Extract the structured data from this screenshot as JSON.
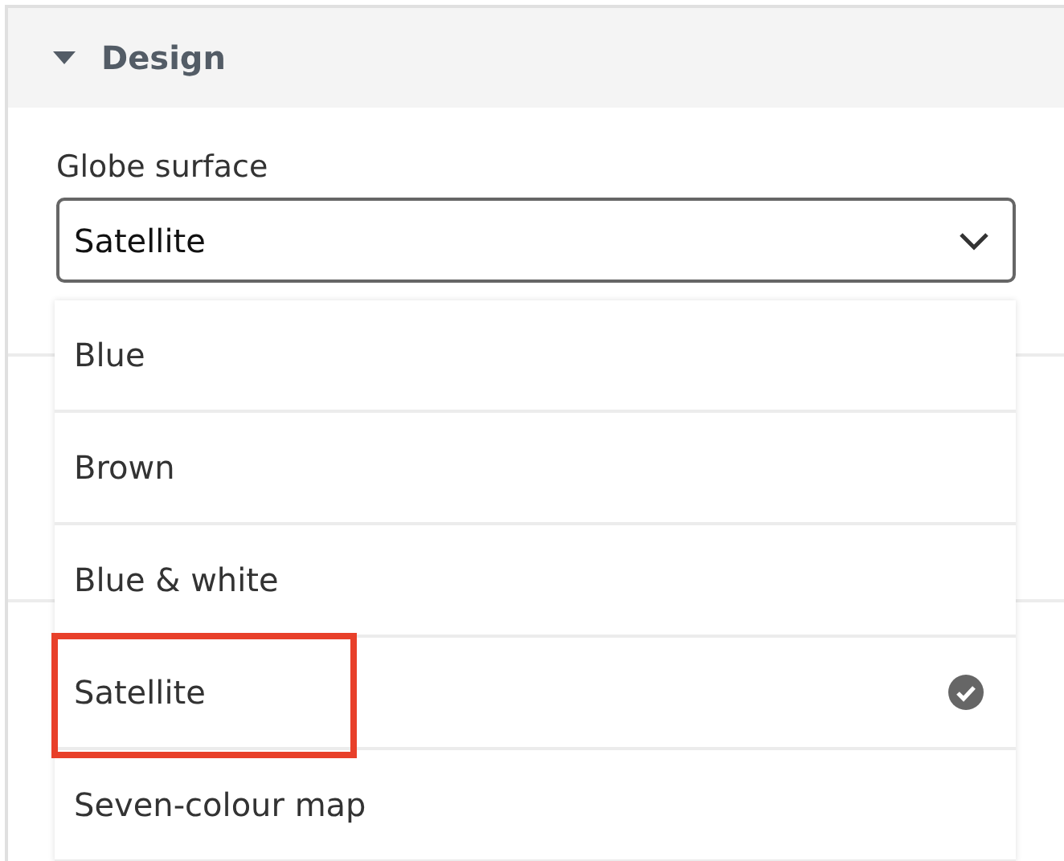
{
  "section": {
    "title": "Design",
    "expanded": true
  },
  "field": {
    "label": "Globe surface",
    "value": "Satellite",
    "open": true
  },
  "options": [
    {
      "label": "Blue",
      "selected": false,
      "annotated": false
    },
    {
      "label": "Brown",
      "selected": false,
      "annotated": false
    },
    {
      "label": "Blue & white",
      "selected": false,
      "annotated": false
    },
    {
      "label": "Satellite",
      "selected": true,
      "annotated": true
    },
    {
      "label": "Seven-colour map",
      "selected": false,
      "annotated": false
    }
  ]
}
